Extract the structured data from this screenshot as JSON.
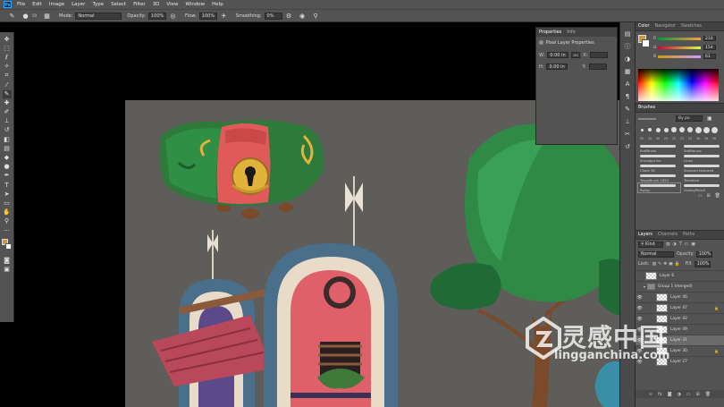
{
  "menu": {
    "items": [
      "File",
      "Edit",
      "Image",
      "Layer",
      "Type",
      "Select",
      "Filter",
      "3D",
      "View",
      "Window",
      "Help"
    ]
  },
  "options_bar": {
    "brush_size": "50",
    "mode_label": "Mode:",
    "mode_value": "Normal",
    "opacity_label": "Opacity:",
    "opacity_value": "100%",
    "flow_label": "Flow:",
    "flow_value": "100%",
    "smoothing_label": "Smoothing:",
    "smoothing_value": "0%"
  },
  "colors": {
    "foreground": "#d29a3d",
    "background": "#ffffff",
    "canvas_gray": "#5e5d5a"
  },
  "properties": {
    "tabs": [
      "Properties",
      "Info"
    ],
    "title": "Pixel Layer Properties",
    "w_label": "W:",
    "w_value": "0.00 in",
    "h_label": "H:",
    "h_value": "0.00 in",
    "link_label": "GO",
    "x_label": "X:",
    "y_label": "Y:"
  },
  "color_panel": {
    "tabs": [
      "Color",
      "Navigator",
      "Swatches"
    ],
    "channels": [
      {
        "label": "R",
        "value": "210"
      },
      {
        "label": "G",
        "value": "154"
      },
      {
        "label": "B",
        "value": "61"
      }
    ]
  },
  "brushes_panel": {
    "tab": "Brushes",
    "search_placeholder": "By px",
    "tip_sizes": [
      "30",
      "30",
      "30",
      "25",
      "25",
      "25",
      "25",
      "36",
      "36",
      "36",
      "36",
      "36"
    ],
    "brushes": [
      "RuffBrush",
      "SoftRound",
      "SmudgeLine",
      "Lines",
      "Chalk 36",
      "Squared textured",
      "TexasBrush 1851",
      "Trendline",
      "Rocky",
      "GrassyPencil"
    ]
  },
  "layers_panel": {
    "tabs": [
      "Layers",
      "Channels",
      "Paths"
    ],
    "filter_label": "Kind",
    "blend_mode": "Normal",
    "opacity_label": "Opacity:",
    "opacity_value": "100%",
    "lock_label": "Lock:",
    "fill_label": "Fill:",
    "fill_value": "100%",
    "layers": [
      {
        "name": "Layer 6",
        "type": "layer",
        "visible": false
      },
      {
        "name": "Group 1 (merged)",
        "type": "group",
        "visible": false
      },
      {
        "name": "Layer 46",
        "type": "layer",
        "visible": true
      },
      {
        "name": "Layer 47",
        "type": "layer",
        "visible": true
      },
      {
        "name": "Layer 42",
        "type": "layer",
        "visible": true
      },
      {
        "name": "Layer 49",
        "type": "layer",
        "visible": true
      },
      {
        "name": "Layer 31",
        "type": "layer",
        "visible": true
      },
      {
        "name": "Layer 30",
        "type": "layer",
        "visible": true
      },
      {
        "name": "Layer 27",
        "type": "layer",
        "visible": true
      }
    ]
  },
  "watermark": {
    "cn": "灵感中国",
    "en": "lingganchina.com"
  }
}
